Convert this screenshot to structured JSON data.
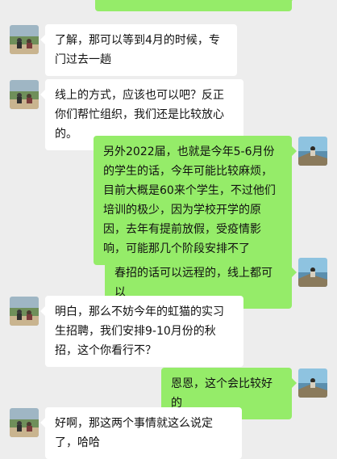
{
  "colors": {
    "background": "#ededed",
    "bubble_received": "#ffffff",
    "bubble_sent": "#95ec69"
  },
  "messages": [
    {
      "side": "right",
      "text": "",
      "truncated_top": true
    },
    {
      "side": "left",
      "text": "了解，那可以等到4月的时候，专门过去一趟"
    },
    {
      "side": "left",
      "text": "线上的方式，应该也可以吧？反正你们帮忙组织，我们还是比较放心的。"
    },
    {
      "side": "right",
      "text": "另外2022届，也就是今年5-6月份的学生的话，今年可能比较麻烦，目前大概是60来个学生，不过他们培训的极少，因为学校开学的原因，去年有提前放假，受疫情影响，可能那几个阶段安排不了"
    },
    {
      "side": "right",
      "text": "春招的话可以远程的，线上都可以"
    },
    {
      "side": "left",
      "text": "明白，那么不妨今年的虹猫的实习生招聘，我们安排9-10月份的秋招，这个你看行不？"
    },
    {
      "side": "right",
      "text": "恩恩，这个会比较好的"
    },
    {
      "side": "left",
      "text": "好啊，那这两个事情就这么说定了，哈哈"
    }
  ]
}
